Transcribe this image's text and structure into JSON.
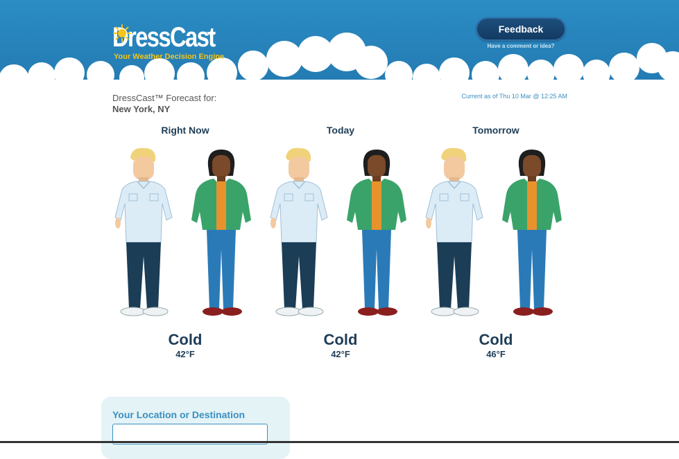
{
  "brand": {
    "name": "DressCast",
    "tm": "TM",
    "tagline": "Your Weather Decision Engine"
  },
  "feedback": {
    "button_label": "Feedback",
    "sub_link": "Have a comment or idea?"
  },
  "forecast": {
    "label": "DressCast™ Forecast for:",
    "city": "New York, NY",
    "current_as_of": "Current as of Thu 10 Mar @ 12:25 AM"
  },
  "periods": [
    {
      "title": "Right Now",
      "condition": "Cold",
      "temp": "42°F"
    },
    {
      "title": "Today",
      "condition": "Cold",
      "temp": "42°F"
    },
    {
      "title": "Tomorrow",
      "condition": "Cold",
      "temp": "46°F"
    }
  ],
  "location": {
    "title": "Your Location or Destination",
    "input_value": ""
  },
  "colors": {
    "header_blue": "#2b8cc4",
    "dark_navy": "#1f3d57",
    "accent_blue": "#3a8fc0",
    "tagline_yellow": "#f5c518"
  }
}
